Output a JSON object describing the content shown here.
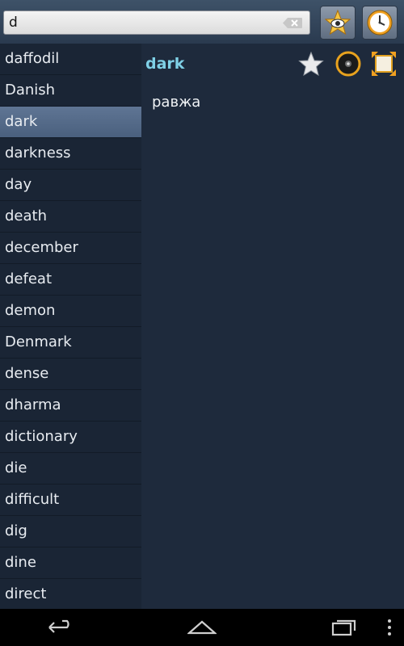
{
  "search": {
    "value": "d"
  },
  "words": [
    "daffodil",
    "Danish",
    "dark",
    "darkness",
    "day",
    "death",
    "december",
    "defeat",
    "demon",
    "Denmark",
    "dense",
    "dharma",
    "dictionary",
    "die",
    "difficult",
    "dig",
    "dine",
    "direct"
  ],
  "selected_index": 2,
  "detail": {
    "headword": "dark",
    "translation": "равжа"
  },
  "icons": {
    "favorites_view": "star-eye-icon",
    "history": "clock-icon",
    "favorite": "star-icon",
    "audio": "speaker-icon",
    "fullscreen": "fullscreen-icon"
  },
  "colors": {
    "headword": "#7fd0e6",
    "selected_row": "#56698a",
    "background": "#1e2a3c"
  }
}
